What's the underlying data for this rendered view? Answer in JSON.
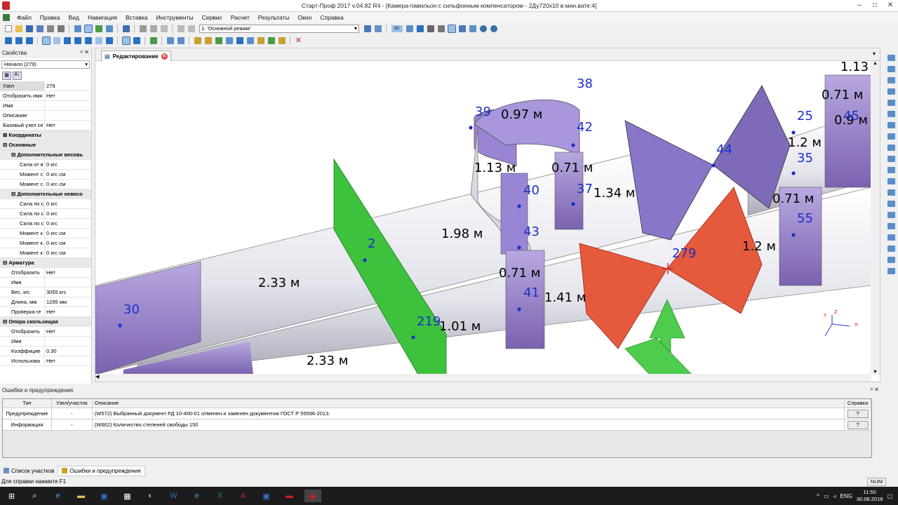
{
  "window": {
    "title": "Старт-Проф 2017 v.04.82 R4 - [Камера-павильон с сильфонным компенсатором - 2Ду720х10 в мин.вате:4]"
  },
  "menu": [
    "Файл",
    "Правка",
    "Вид",
    "Навигация",
    "Вставка",
    "Инструменты",
    "Сервис",
    "Расчет",
    "Результаты",
    "Окно",
    "Справка"
  ],
  "toolbar": {
    "mode": "1. 'Основной режим'",
    "btn3d": "3D"
  },
  "props": {
    "title": "Свойства",
    "selected": "Начало (279)",
    "rows": [
      {
        "k": "Узел",
        "v": "279"
      },
      {
        "k": "Отобразить имя",
        "v": "Нет"
      },
      {
        "k": "Имя",
        "v": ""
      },
      {
        "k": "Описание",
        "v": ""
      },
      {
        "k": "Базовый узел се",
        "v": "Нет"
      }
    ],
    "g_coords": "Координаты",
    "g_main": "Основные",
    "g_addw": "Дополнительные весовь",
    "addw": [
      {
        "k": "Сила от в",
        "v": "0 кгс"
      },
      {
        "k": "Момент с",
        "v": "0 кгс·см"
      },
      {
        "k": "Момент с",
        "v": "0 кгс·см"
      }
    ],
    "g_addnw": "Дополнительные невесо",
    "addnw": [
      {
        "k": "Сила по с",
        "v": "0 кгс"
      },
      {
        "k": "Сила по с",
        "v": "0 кгс"
      },
      {
        "k": "Сила по с",
        "v": "0 кгс"
      },
      {
        "k": "Момент к",
        "v": "0 кгс·см"
      },
      {
        "k": "Момент к",
        "v": "0 кгс·см"
      },
      {
        "k": "Момент к",
        "v": "0 кгс·см"
      }
    ],
    "g_arm": "Арматура",
    "arm": [
      {
        "k": "Отобразить",
        "v": "Нет"
      },
      {
        "k": "Имя",
        "v": ""
      },
      {
        "k": "Вес, кгс",
        "v": "3055 кгс"
      },
      {
        "k": "Длина, мм",
        "v": "1295 мм"
      },
      {
        "k": "Проверка ге",
        "v": "Нет"
      }
    ],
    "g_sup": "Опора скользящая",
    "sup": [
      {
        "k": "Отобразить",
        "v": "Нет"
      },
      {
        "k": "Имя",
        "v": ""
      },
      {
        "k": "Коэффицие",
        "v": "0.30"
      },
      {
        "k": "Использова",
        "v": "Нет"
      }
    ]
  },
  "editor": {
    "tab": "Редактирование"
  },
  "scene": {
    "lengths": [
      "1.13",
      "0.97 м",
      "0.71 м",
      "1.13 м",
      "0.71 м",
      "1.34 м",
      "1.98 м",
      "2.33 м",
      "0.71 м",
      "1.41 м",
      "1.01 м",
      "2.33 м",
      "1.2 м",
      "0.9 м",
      "0.71 м",
      "1.2 м"
    ],
    "nodes": [
      "38",
      "39",
      "42",
      "40",
      "37",
      "43",
      "41",
      "2",
      "30",
      "219",
      "279",
      "44",
      "25",
      "45",
      "35",
      "55"
    ],
    "axes": [
      "Y",
      "Z",
      "X"
    ]
  },
  "errors": {
    "title": "Ошибки и предупреждения",
    "headers": [
      "Тип",
      "Узел/участок",
      "Описание",
      "Справка"
    ],
    "rows": [
      {
        "type": "Предупреждение",
        "node": "-",
        "desc": "(W572) Выбранный документ РД 10-400-01 отменен и заменен документом ГОСТ Р 55596-2013.",
        "help": "?"
      },
      {
        "type": "Информация",
        "node": "-",
        "desc": "(W662) Количество степеней свободы 150",
        "help": "?"
      }
    ]
  },
  "bottomtabs": [
    "Список участков",
    "Ошибки и предупреждения"
  ],
  "status": {
    "text": "Для справки нажмите F1",
    "num": "NUM"
  },
  "tray": {
    "lang": "ENG",
    "time": "11:50",
    "date": "30.08.2018"
  }
}
